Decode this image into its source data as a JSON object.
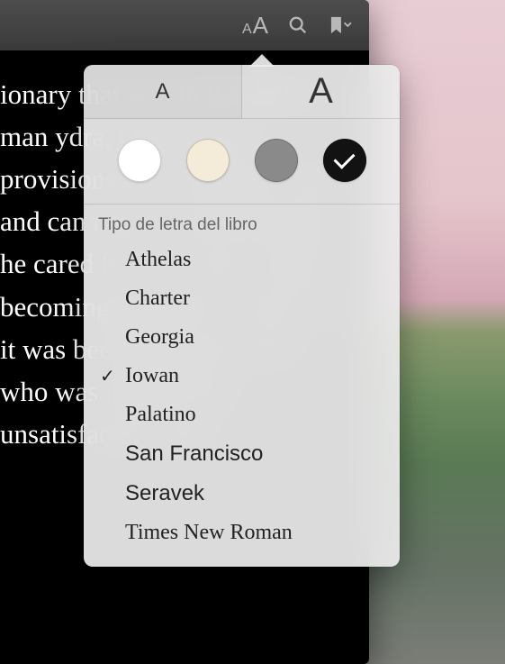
{
  "reader": {
    "visible_text": "ionary that was in the dark. A man ydra, but as he ng provisions, he a financier, and , and can never e mind keeping he cared for it, in ance it gave, becoming apparent in ned, and it was becoming tain secret who was mbitter his e unsatisfactory state"
  },
  "toolbar": {
    "font_icon_small": "A",
    "font_icon_large": "A"
  },
  "popover": {
    "decrease_label": "A",
    "increase_label": "A",
    "themes": [
      {
        "name": "white",
        "color": "#ffffff",
        "selected": false
      },
      {
        "name": "sepia",
        "color": "#f4ecd8",
        "selected": false
      },
      {
        "name": "gray",
        "color": "#8a8a8a",
        "selected": false
      },
      {
        "name": "night",
        "color": "#121212",
        "selected": true
      }
    ],
    "font_section_label": "Tipo de letra del libro",
    "fonts": [
      {
        "name": "Athelas",
        "class": "f-athelas",
        "selected": false
      },
      {
        "name": "Charter",
        "class": "f-charter",
        "selected": false
      },
      {
        "name": "Georgia",
        "class": "f-georgia",
        "selected": false
      },
      {
        "name": "Iowan",
        "class": "f-iowan",
        "selected": true
      },
      {
        "name": "Palatino",
        "class": "f-palatino",
        "selected": false
      },
      {
        "name": "San Francisco",
        "class": "f-sf",
        "selected": false
      },
      {
        "name": "Seravek",
        "class": "f-seravek",
        "selected": false
      },
      {
        "name": "Times New Roman",
        "class": "f-tnr",
        "selected": false
      }
    ]
  }
}
